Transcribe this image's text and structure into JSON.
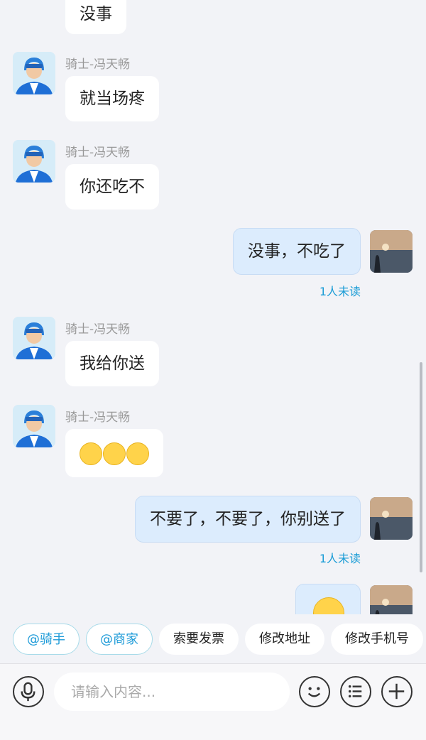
{
  "messages": [
    {
      "text": "没事"
    },
    {
      "sender": "骑士-冯天畅",
      "text": "就当场疼"
    },
    {
      "sender": "骑士-冯天畅",
      "text": "你还吃不"
    },
    {
      "text": "没事，不吃了",
      "status": "1人未读"
    },
    {
      "sender": "骑士-冯天畅",
      "text": "我给你送"
    },
    {
      "sender": "骑士-冯天畅",
      "emoji": [
        "pleading-face",
        "pleading-face",
        "pleading-face"
      ]
    },
    {
      "text": "不要了，不要了，你别送了",
      "status": "1人未读"
    },
    {
      "emoji": [
        "crying-face"
      ]
    }
  ],
  "quick_actions": [
    "@骑手",
    "@商家",
    "索要发票",
    "修改地址",
    "修改手机号"
  ],
  "input": {
    "placeholder": "请输入内容..."
  },
  "icons": {
    "voice": "microphone-icon",
    "emoji": "smiley-icon",
    "list": "list-icon",
    "more": "plus-icon"
  },
  "colors": {
    "accent": "#1e9bd8",
    "outgoing_bubble": "#dcecfd",
    "incoming_bubble": "#ffffff",
    "background": "#f2f3f7"
  }
}
